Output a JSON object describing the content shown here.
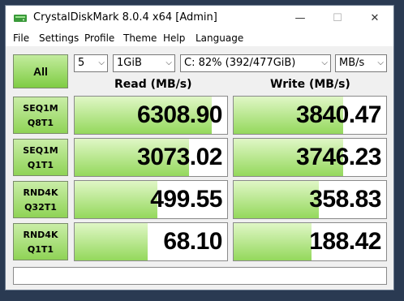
{
  "window": {
    "title": "CrystalDiskMark 8.0.4 x64 [Admin]",
    "min_glyph": "—",
    "max_glyph": "☐",
    "close_glyph": "✕"
  },
  "menu": [
    "File",
    "Settings",
    "Profile",
    "Theme",
    "Help",
    "Language"
  ],
  "controls": {
    "all_label": "All",
    "count": "5",
    "size": "1GiB",
    "drive": "C: 82% (392/477GiB)",
    "unit": "MB/s"
  },
  "headers": {
    "read": "Read (MB/s)",
    "write": "Write (MB/s)"
  },
  "tests": [
    {
      "line1": "SEQ1M",
      "line2": "Q8T1",
      "read": "6308.90",
      "write": "3840.47",
      "read_fill": 0.9,
      "write_fill": 0.72
    },
    {
      "line1": "SEQ1M",
      "line2": "Q1T1",
      "read": "3073.02",
      "write": "3746.23",
      "read_fill": 0.75,
      "write_fill": 0.72
    },
    {
      "line1": "RND4K",
      "line2": "Q32T1",
      "read": "499.55",
      "write": "358.83",
      "read_fill": 0.54,
      "write_fill": 0.56
    },
    {
      "line1": "RND4K",
      "line2": "Q1T1",
      "read": "68.10",
      "write": "188.42",
      "read_fill": 0.48,
      "write_fill": 0.51
    }
  ],
  "comment": ""
}
